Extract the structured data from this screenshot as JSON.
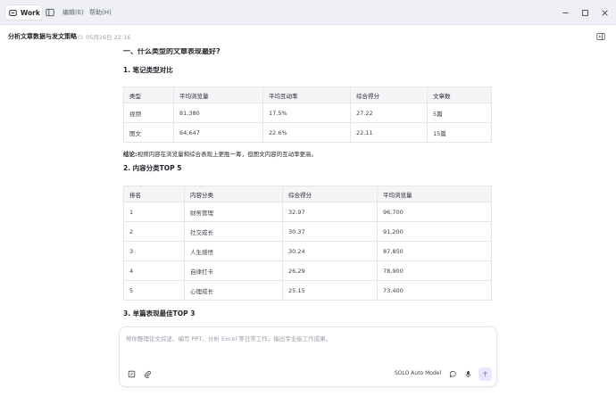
{
  "titlebar": {
    "mode_label": "Work",
    "menu": [
      "编辑(E)",
      "帮助(H)"
    ]
  },
  "doc": {
    "title": "分析文章数据与发文策略",
    "timestamp": "05月26日 22:16"
  },
  "content": {
    "cut_heading": "一、什么类型的文章表现最好?",
    "section1": {
      "heading": "1. 笔记类型对比",
      "columns": [
        "类型",
        "平均浏览量",
        "平均互动率",
        "综合得分",
        "文章数"
      ],
      "rows": [
        [
          "视频",
          "81,380",
          "17.5%",
          "27.22",
          "5篇"
        ],
        [
          "图文",
          "64,647",
          "22.6%",
          "22.11",
          "15篇"
        ]
      ],
      "conclusion_label": "结论:",
      "conclusion_text": "视频内容在浏览量和综合表现上更胜一筹，但图文内容的互动率更高。"
    },
    "section2": {
      "heading": "2. 内容分类TOP 5",
      "columns": [
        "排名",
        "内容分类",
        "综合得分",
        "平均浏览量"
      ],
      "rows": [
        [
          "1",
          "财务管理",
          "32.97",
          "96,700"
        ],
        [
          "2",
          "社交成长",
          "30.37",
          "91,200"
        ],
        [
          "3",
          "人生感悟",
          "30.24",
          "87,850"
        ],
        [
          "4",
          "自律打卡",
          "26.29",
          "78,900"
        ],
        [
          "5",
          "心理成长",
          "25.15",
          "73,400"
        ]
      ]
    },
    "section3": {
      "heading": "3. 单篇表现最佳TOP 3"
    }
  },
  "composer": {
    "placeholder": "帮你整理论文综述、编写 PPT、分析 Excel 等日常工作，输出专业级工作成果。",
    "value": "",
    "model_label": "SOLO Auto Model"
  },
  "colors": {
    "titlebar_bg": "#eef0f5",
    "table_header_bg": "#f4f5f7",
    "send_button_bg": "#ebe7fb",
    "accent": "#6b5be0"
  },
  "icons": {
    "mode": "work-mode-icon",
    "sidebar": "sidebar-toggle-icon",
    "minimize": "minimize-icon",
    "maximize": "maximize-icon",
    "close": "close-icon",
    "cloud": "cloud-icon",
    "panel": "panel-toggle-icon",
    "attach_context": "context-icon",
    "attach_file": "paperclip-icon",
    "chat": "chat-bubble-icon",
    "mic": "microphone-icon",
    "send": "arrow-up-icon"
  }
}
